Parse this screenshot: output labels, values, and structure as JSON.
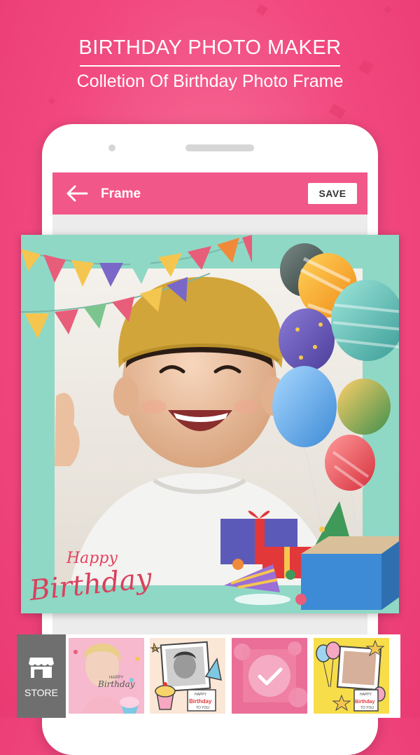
{
  "promo": {
    "title": "BIRTHDAY PHOTO MAKER",
    "subtitle": "Colletion Of Birthday Photo Frame"
  },
  "appbar": {
    "back_icon": "back-arrow-icon",
    "title": "Frame",
    "save_label": "SAVE"
  },
  "frame": {
    "greeting_line1": "Happy",
    "greeting_line2": "Birthday"
  },
  "store": {
    "icon": "store-icon",
    "label": "STORE"
  },
  "thumbnails": [
    {
      "name": "frame-thumb-woman-cupcake",
      "selected": false,
      "caption1": "HAPPY",
      "caption2": "Birthday"
    },
    {
      "name": "frame-thumb-kid-cupcake",
      "selected": false,
      "caption1": "HAPPY",
      "caption2": "Birthday",
      "caption3": "TO YOU"
    },
    {
      "name": "frame-thumb-pink-balloons",
      "selected": true
    },
    {
      "name": "frame-thumb-yellow-stars",
      "selected": false,
      "caption1": "HAPPY",
      "caption2": "Birthday",
      "caption3": "TO YOU"
    }
  ],
  "colors": {
    "background": "#f1487f",
    "appbar": "#f2578a",
    "frame_mint": "#8fd8c5",
    "store_button": "#6f6f6f"
  }
}
